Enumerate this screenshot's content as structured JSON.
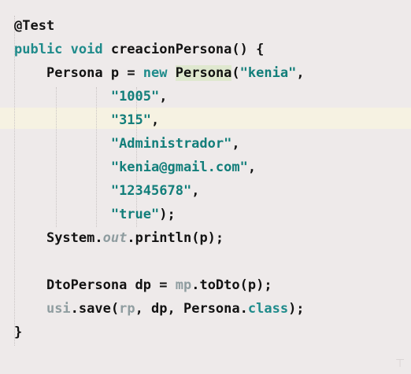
{
  "code": {
    "annotation": "@Test",
    "method": {
      "modifiers": "public void ",
      "name": "creacionPersona",
      "signature_tail": "() {"
    },
    "line3": {
      "type": "Persona",
      "var": " p = ",
      "new_kw": "new",
      "class_name": "Persona",
      "args_open": "(",
      "arg1": "\"kenia\"",
      "comma": ","
    },
    "args": [
      {
        "value": "\"1005\"",
        "suffix": ","
      },
      {
        "value": "\"315\"",
        "suffix": ","
      },
      {
        "value": "\"Administrador\"",
        "suffix": ","
      },
      {
        "value": "\"kenia@gmail.com\"",
        "suffix": ","
      },
      {
        "value": "\"12345678\"",
        "suffix": ","
      },
      {
        "value": "\"true\"",
        "suffix": ");"
      }
    ],
    "print_line": {
      "system": "System.",
      "out": "out",
      "rest": ".println(p);"
    },
    "dto_line": {
      "type": "DtoPersona",
      "assign": " dp = ",
      "mp": "mp",
      "rest": ".toDto(p);"
    },
    "save_line": {
      "usi": "usi",
      "call": ".save(",
      "rp": "rp",
      "mid": ", dp, Persona.",
      "class_kw": "class",
      "end": ");"
    },
    "closing_brace": "}"
  },
  "colors": {
    "background": "#eeeaea",
    "keyword": "#1f8b8b",
    "string": "#127e7a",
    "field": "#8f9da0",
    "text": "#121212",
    "caret_line": "#f6f2e2",
    "highlight": "#dfe8cf"
  },
  "icons": {
    "scroll_marker": "text-cursor-icon"
  }
}
